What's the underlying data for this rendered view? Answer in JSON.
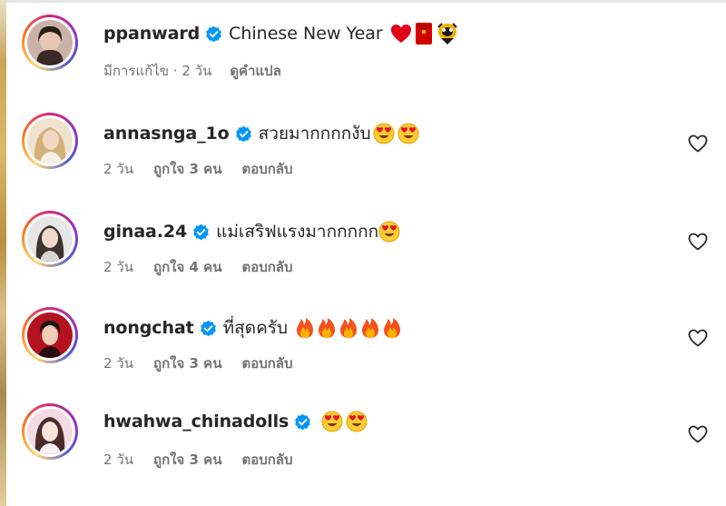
{
  "post": {
    "username": "ppanward",
    "caption": "Chinese New Year",
    "edited_label": "มีการแก้ไข",
    "time": "2 วัน",
    "see_translation": "ดูคำแปล",
    "emojis": [
      "red-heart",
      "red-envelope",
      "lion-dance"
    ]
  },
  "comments": [
    {
      "username": "annasnga_1o",
      "text": "สวยมากกกกงับ",
      "emojis": [
        "heart-eyes",
        "heart-eyes"
      ],
      "time": "2 วัน",
      "likes": "ถูกใจ 3 คน",
      "reply": "ตอบกลับ"
    },
    {
      "username": "ginaa.24",
      "text": "แม่เสริฟแรงมากกกกก",
      "emojis": [
        "heart-eyes"
      ],
      "time": "2 วัน",
      "likes": "ถูกใจ 4 คน",
      "reply": "ตอบกลับ"
    },
    {
      "username": "nongchat",
      "text": "ที่สุดครับ",
      "emojis": [
        "fire",
        "fire",
        "fire",
        "fire",
        "fire"
      ],
      "time": "2 วัน",
      "likes": "ถูกใจ 3 คน",
      "reply": "ตอบกลับ"
    },
    {
      "username": "hwahwa_chinadolls",
      "text": "",
      "emojis": [
        "heart-eyes",
        "heart-eyes"
      ],
      "time": "2 วัน",
      "likes": "ถูกใจ 3 คน",
      "reply": "ตอบกลับ"
    }
  ],
  "colors": {
    "verified": "#0095f6",
    "text": "#262626",
    "muted": "#737373"
  }
}
